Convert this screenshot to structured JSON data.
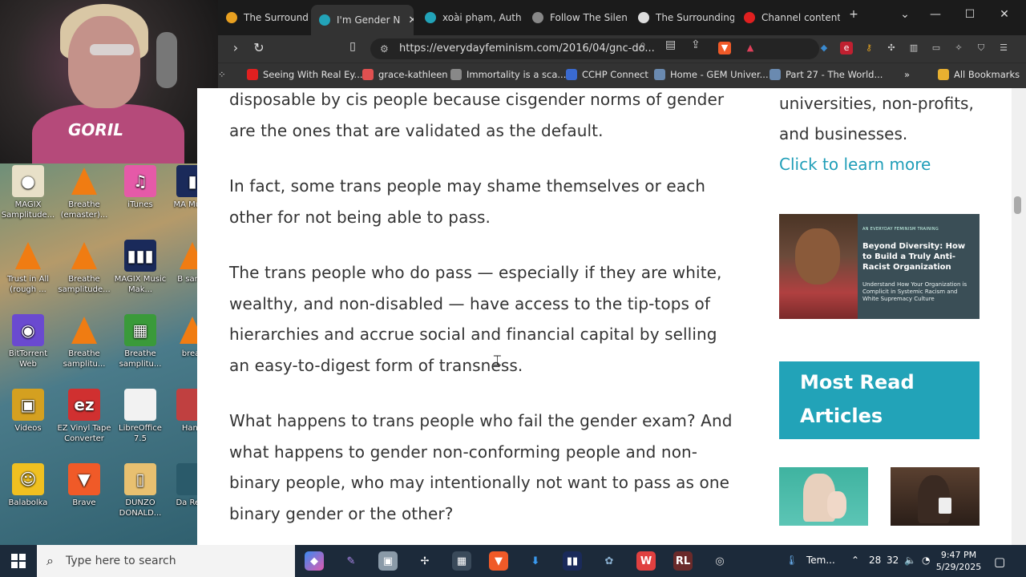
{
  "desktop": {
    "icons": [
      {
        "label": "MAGIX Samplitude...",
        "color": "#e8e0c8",
        "glyph": "●"
      },
      {
        "label": "Breathe (emaster)...",
        "color": "",
        "glyph": ""
      },
      {
        "label": "iTunes",
        "color": "#e55aa8",
        "glyph": "♫"
      },
      {
        "label": "MA Music",
        "color": "#1a2a5a",
        "glyph": "▮"
      },
      {
        "label": "Trust in All (rough ...",
        "color": "",
        "glyph": ""
      },
      {
        "label": "Breathe samplitude...",
        "color": "",
        "glyph": ""
      },
      {
        "label": "MAGIX Music Mak...",
        "color": "#1a2a5a",
        "glyph": "▮▮▮"
      },
      {
        "label": "B samp",
        "color": "",
        "glyph": ""
      },
      {
        "label": "BitTorrent Web",
        "color": "#6a4ad0",
        "glyph": "◉"
      },
      {
        "label": "Breathe samplitu...",
        "color": "",
        "glyph": ""
      },
      {
        "label": "Breathe samplitu...",
        "color": "#3a9a3a",
        "glyph": "▦"
      },
      {
        "label": "breat",
        "color": "",
        "glyph": ""
      },
      {
        "label": "Videos",
        "color": "#d4a020",
        "glyph": "▣"
      },
      {
        "label": "EZ Vinyl Tape Converter",
        "color": "#d03030",
        "glyph": "ez"
      },
      {
        "label": "LibreOffice 7.5",
        "color": "#f2f2f2",
        "glyph": ""
      },
      {
        "label": "Hand",
        "color": "#c04040",
        "glyph": ""
      },
      {
        "label": "Balabolka",
        "color": "#f0c020",
        "glyph": "☺"
      },
      {
        "label": "Brave",
        "color": "#f05a28",
        "glyph": "▼"
      },
      {
        "label": "DUNZO DONALD...",
        "color": "#e8c070",
        "glyph": "▯"
      },
      {
        "label": "Da Rese",
        "color": "#2a5a6a",
        "glyph": ""
      }
    ]
  },
  "webcam": {
    "shirt_text": "GORIL"
  },
  "browser": {
    "tabs": [
      {
        "title": "The Surrounding",
        "color": "#e8a020"
      },
      {
        "title": "I'm Gender N",
        "color": "#22a3b8"
      },
      {
        "title": "xoài phạm, Autho",
        "color": "#22a3b8"
      },
      {
        "title": "Follow The Silenc",
        "color": "#888888"
      },
      {
        "title": "The Surrounding",
        "color": "#dddddd"
      },
      {
        "title": "Channel content",
        "color": "#e02020"
      }
    ],
    "new_tab": "+",
    "url": "https://everydayfeminism.com/2016/04/gnc-do...",
    "bookmarks": [
      {
        "label": "Seeing With Real Ey...",
        "color": "#e02020"
      },
      {
        "label": "grace-kathleen",
        "color": "#e05050"
      },
      {
        "label": "Immortality is a sca...",
        "color": "#888888"
      },
      {
        "label": "CCHP Connect",
        "color": "#3a6ad0"
      },
      {
        "label": "Home - GEM Univer...",
        "color": "#6a8ab0"
      },
      {
        "label": "Part 27 - The World...",
        "color": "#6a8ab0"
      }
    ],
    "all_bookmarks": "All Bookmarks"
  },
  "article": {
    "paragraphs": [
      "disposable by cis people because cisgender norms of gender are the ones that are validated as the default.",
      "In fact, some trans people may shame themselves or each other for not being able to pass.",
      "The trans people who do pass — especially if they are white, wealthy, and non-disabled —  have access to the tip-tops of hierarchies and accrue social and financial capital by selling an easy-to-digest form of transness.",
      "What happens to trans people who fail the gender exam? And what happens to gender non-conforming people and non-binary people, who may intentionally not want to pass as one binary gender or the other?"
    ]
  },
  "sidebar": {
    "text": "universities, non-profits, and businesses.",
    "link": "Click to learn more",
    "promo": {
      "small": "AN EVERYDAY FEMINISM TRAINING",
      "title": "Beyond Diversity: How to Build a Truly Anti-Racist Organization",
      "subtitle": "Understand How Your Organization is Complicit in Systemic Racism and White Supremacy Culture"
    },
    "most_read": "Most Read Articles"
  },
  "taskbar": {
    "search_placeholder": "Type here to search",
    "weather": "Tem...",
    "tray_a": "28",
    "tray_b": "32",
    "time": "9:47 PM",
    "date": "5/29/2025"
  }
}
